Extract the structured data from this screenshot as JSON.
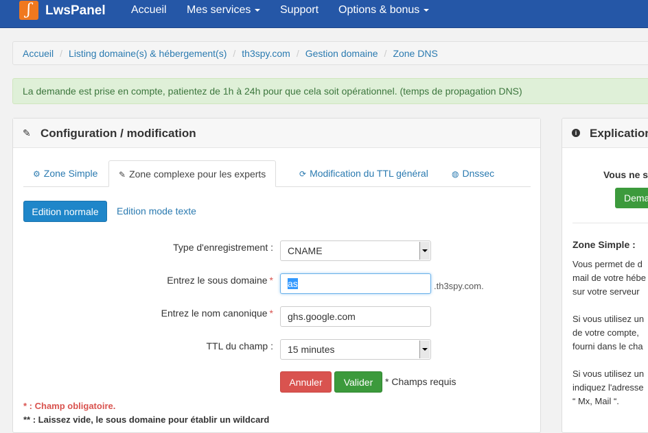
{
  "navbar": {
    "logo_glyph": "ʃ",
    "brand": "LwsPanel",
    "items": [
      {
        "label": "Accueil"
      },
      {
        "label": "Mes services"
      },
      {
        "label": "Support"
      },
      {
        "label": "Options & bonus"
      }
    ]
  },
  "breadcrumb": [
    "Accueil",
    "Listing domaine(s) & hébergement(s)",
    "th3spy.com",
    "Gestion domaine",
    "Zone DNS"
  ],
  "alert": {
    "text": "La demande est prise en compte, patientez de 1h à 24h pour que cela soit opérationnel. (temps de propagation DNS)"
  },
  "config_panel": {
    "title": "Configuration / modification",
    "tabs": [
      {
        "icon": "gear-icon",
        "glyph": "⚙",
        "label": "Zone Simple"
      },
      {
        "icon": "pencil-icon",
        "glyph": "✎",
        "label": "Zone complexe pour les experts"
      },
      {
        "icon": "refresh-icon",
        "glyph": "⟳",
        "label": "Modification du TTL général"
      },
      {
        "icon": "globe-icon",
        "glyph": "◍",
        "label": "Dnssec"
      }
    ],
    "edit_normal_label": "Edition normale",
    "edit_text_label": "Edition mode texte",
    "form": {
      "type_label": "Type d'enregistrement :",
      "type_value": "CNAME",
      "subdomain_label": "Entrez le sous domaine",
      "subdomain_value": "as",
      "subdomain_suffix": ".th3spy.com.",
      "canonical_label": "Entrez le nom canonique",
      "canonical_value": "ghs.google.com",
      "ttl_label": "TTL du champ :",
      "ttl_value": "15 minutes",
      "required_mark": "*"
    },
    "cancel_label": "Annuler",
    "validate_label": "Valider",
    "required_note": "* Champs requis",
    "note_mandatory": "* : Champ obligatoire.",
    "note_wildcard": "** : Laissez vide, le sous domaine pour établir un wildcard"
  },
  "explication_panel": {
    "title": "Explication",
    "vous_text": "Vous ne s",
    "button_text": "Dema",
    "zone_simple_title": "Zone Simple :",
    "lines": [
      "Vous permet de d",
      "mail de votre hébe",
      "sur votre serveur",
      "Si vous utilisez un",
      "de votre compte,",
      "fourni dans le cha",
      "Si vous utilisez un",
      "indiquez l'adresse",
      "“ Mx, Mail “."
    ]
  },
  "colors": {
    "navbar": "#2557a7",
    "primary": "#1f86c9",
    "success": "#3c9a3c",
    "danger": "#d9534f",
    "link": "#2a7ab0"
  }
}
